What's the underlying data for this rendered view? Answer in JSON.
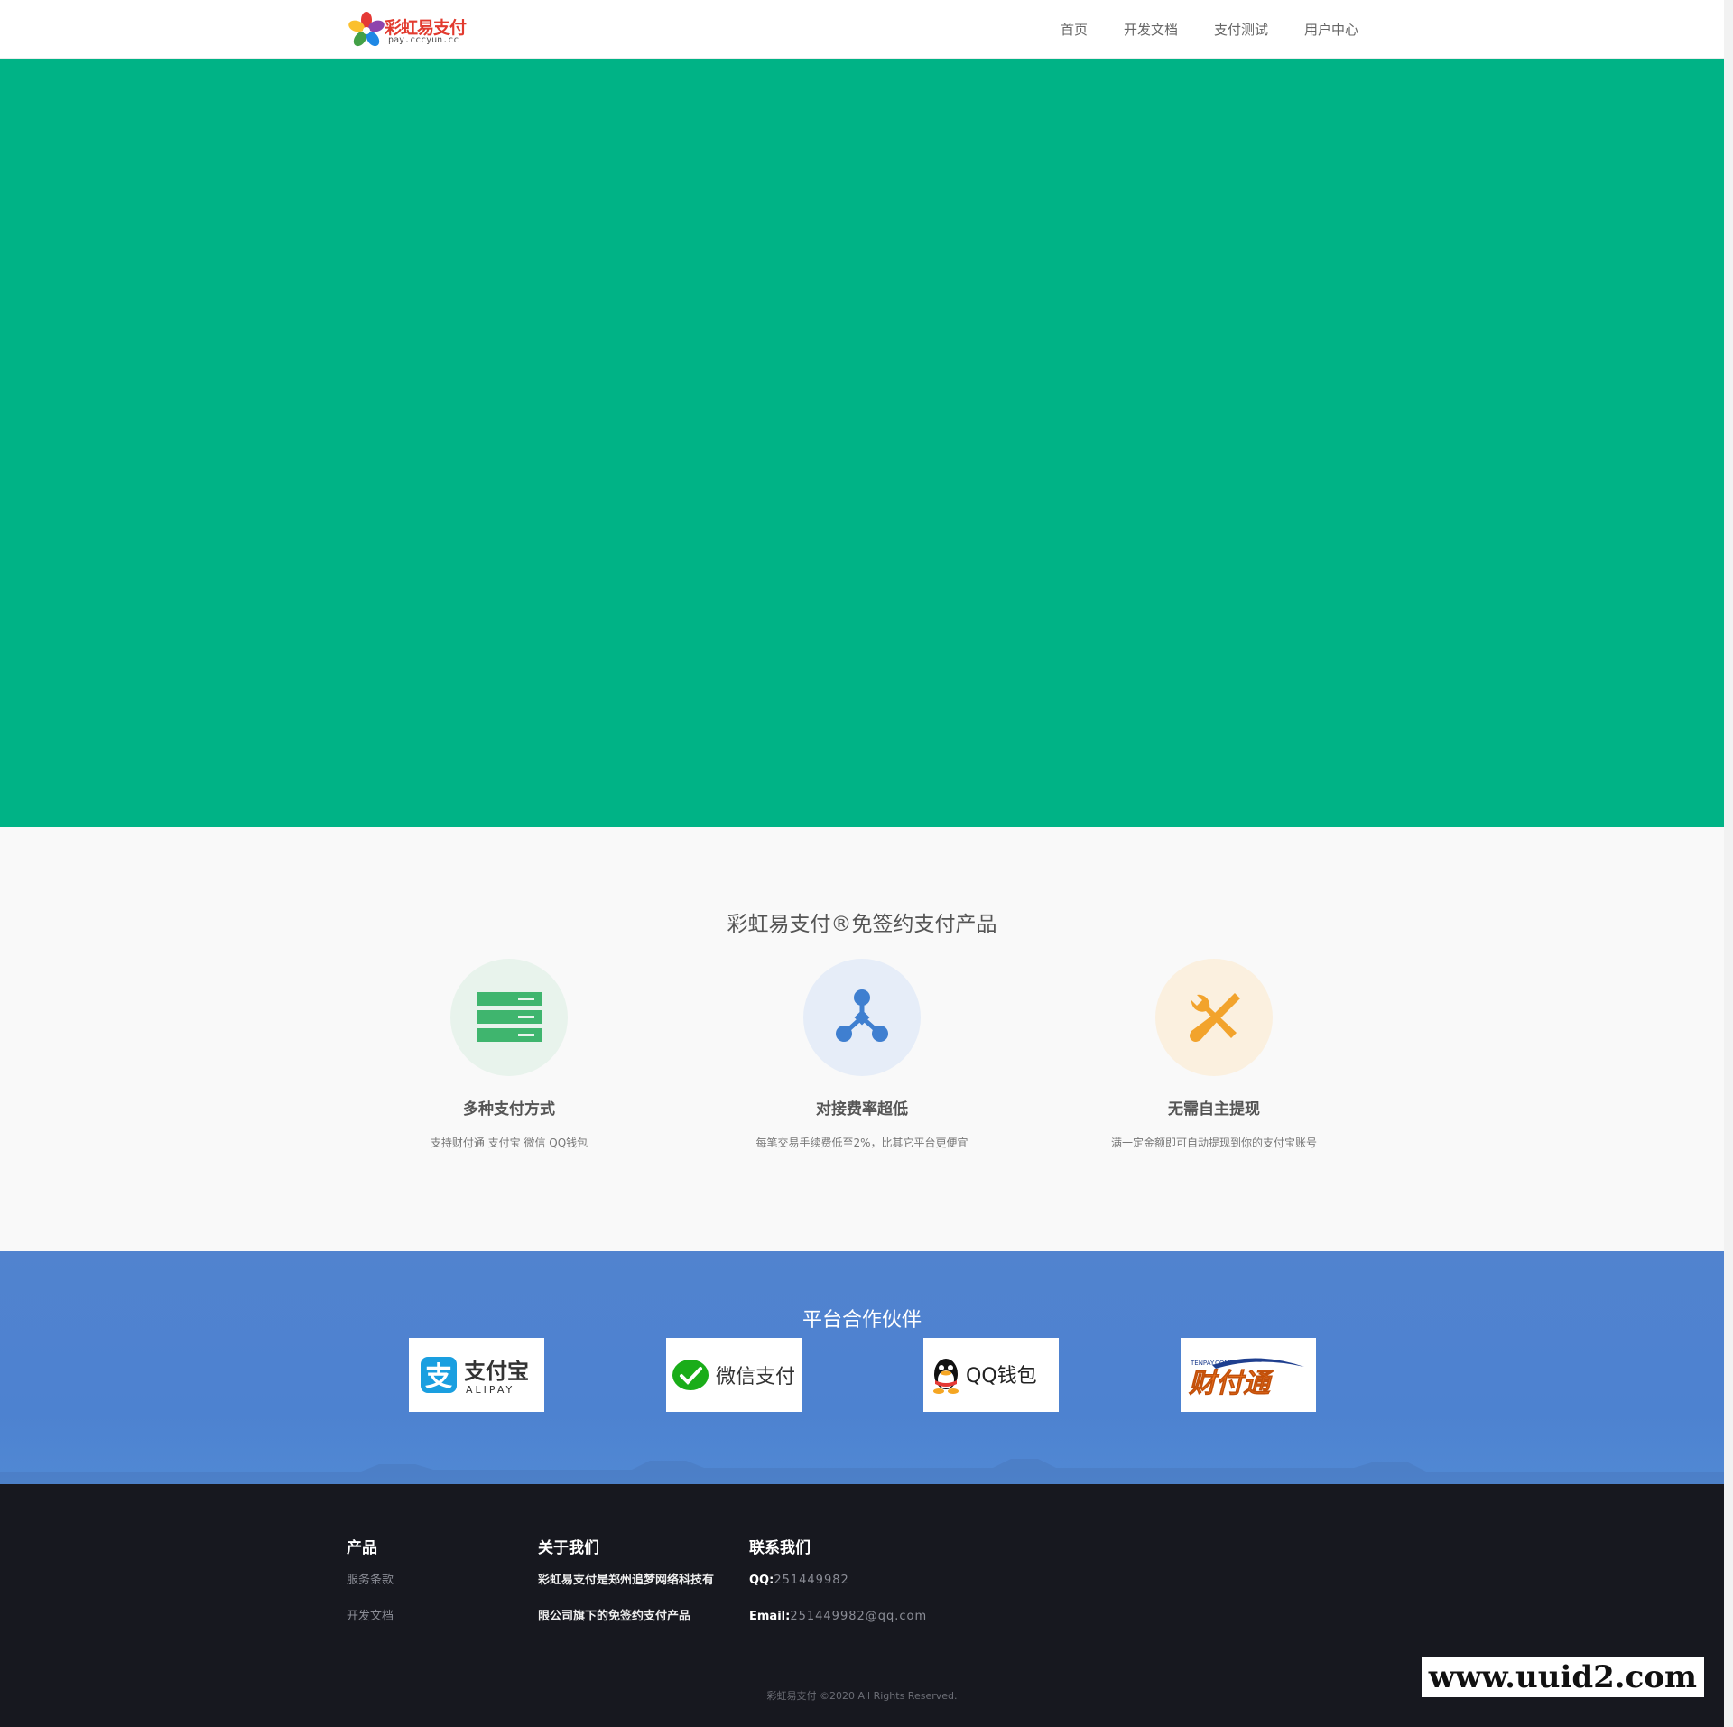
{
  "header": {
    "logo_title": "彩虹易支付",
    "logo_sub": "pay.cccyun.cc",
    "nav": [
      "首页",
      "开发文档",
      "支付测试",
      "用户中心"
    ]
  },
  "colors": {
    "hero": "#00b386",
    "products_bg": "#f9f9f9",
    "partners_bg": "#4d82d0",
    "footer_bg": "#17181f",
    "feature1_icon": "#3fb56e",
    "feature2_icon": "#3f7fd0",
    "feature3_icon": "#f2a32c"
  },
  "products": {
    "title": "彩虹易支付®免签约支付产品",
    "features": [
      {
        "icon": "server-stack-icon",
        "title": "多种支付方式",
        "desc": "支持财付通 支付宝 微信 QQ钱包"
      },
      {
        "icon": "network-nodes-icon",
        "title": "对接费率超低",
        "desc": "每笔交易手续费低至2%，比其它平台更便宜"
      },
      {
        "icon": "wrench-screwdriver-icon",
        "title": "无需自主提现",
        "desc": "满一定金额即可自动提现到你的支付宝账号"
      }
    ]
  },
  "partners": {
    "title": "平台合作伙伴",
    "items": [
      {
        "icon": "alipay-logo",
        "name": "支付宝",
        "sub": "ALIPAY"
      },
      {
        "icon": "wechat-pay-logo",
        "name": "微信支付"
      },
      {
        "icon": "qq-wallet-logo",
        "name": "QQ钱包"
      },
      {
        "icon": "tenpay-logo",
        "name": "财付通",
        "sub": "TENPAY.COM"
      }
    ]
  },
  "footer": {
    "col_product": {
      "title": "产品",
      "links": [
        "服务条款",
        "开发文档"
      ]
    },
    "col_about": {
      "title": "关于我们",
      "lines": [
        "彩虹易支付是郑州追梦网络科技有",
        "限公司旗下的免签约支付产品"
      ]
    },
    "col_contact": {
      "title": "联系我们",
      "qq_label": "QQ:",
      "qq": "251449982",
      "email_label": "Email:",
      "email": "251449982@qq.com"
    },
    "copyright": "彩虹易支付  ©2020 All Rights Reserved.",
    "watermark": "www.uuid2.com"
  }
}
